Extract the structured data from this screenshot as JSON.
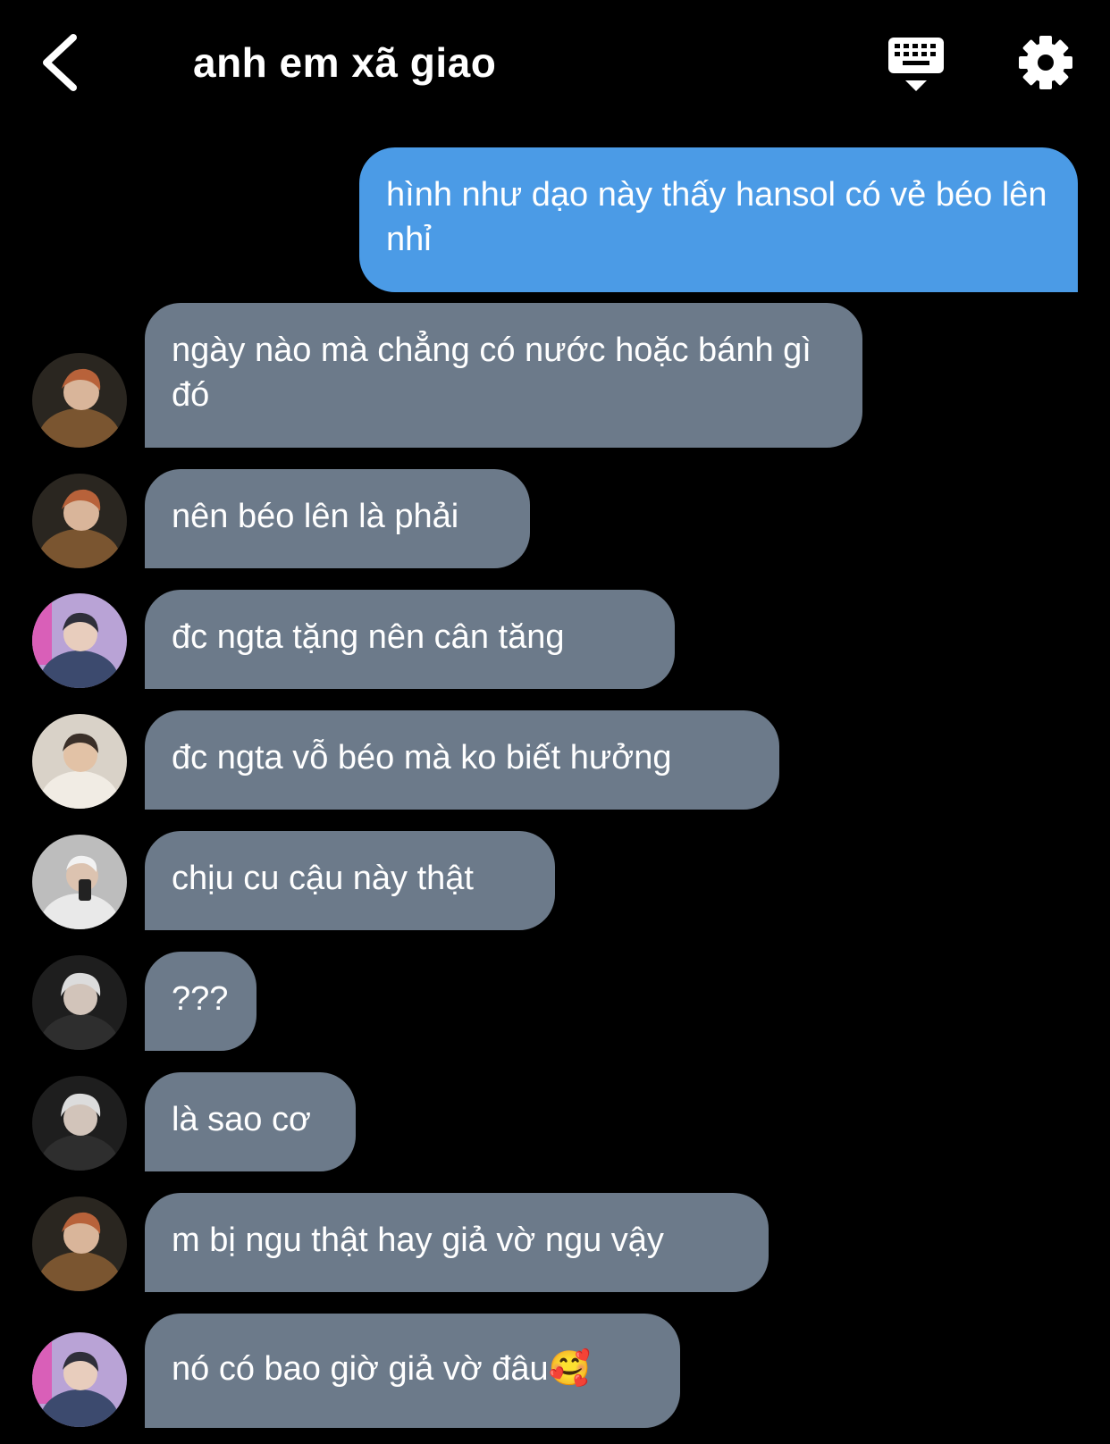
{
  "header": {
    "title": "anh em xã giao",
    "back_icon": "chevron-left-icon",
    "keyboard_icon": "keyboard-hide-icon",
    "settings_icon": "gear-icon"
  },
  "colors": {
    "background": "#000000",
    "outgoing_bubble": "#4b9be6",
    "incoming_bubble": "#6c7a8a",
    "text": "#ffffff"
  },
  "messages": [
    {
      "direction": "out",
      "text": "hình như dạo này thấy hansol có vẻ béo lên nhỉ"
    },
    {
      "direction": "in",
      "avatar": "avatar-brown-jacket",
      "text": "ngày nào mà chẳng có nước hoặc bánh gì đó"
    },
    {
      "direction": "in",
      "avatar": "avatar-brown-jacket",
      "text": "nên béo lên là phải"
    },
    {
      "direction": "in",
      "avatar": "avatar-neon-hoodie",
      "text": "đc ngta tặng nên cân tăng"
    },
    {
      "direction": "in",
      "avatar": "avatar-white-tee",
      "text": "đc ngta vỗ béo mà ko biết hưởng"
    },
    {
      "direction": "in",
      "avatar": "avatar-mirror-selfie",
      "text": "chịu cu cậu này thật"
    },
    {
      "direction": "in",
      "avatar": "avatar-silver-hair",
      "text": "???"
    },
    {
      "direction": "in",
      "avatar": "avatar-silver-hair",
      "text": "là sao cơ"
    },
    {
      "direction": "in",
      "avatar": "avatar-brown-jacket",
      "text": "m bị ngu thật hay giả vờ ngu vậy"
    },
    {
      "direction": "in",
      "avatar": "avatar-neon-hoodie",
      "text": "nó có bao giờ giả vờ đâu",
      "emoji": "🥰"
    }
  ]
}
